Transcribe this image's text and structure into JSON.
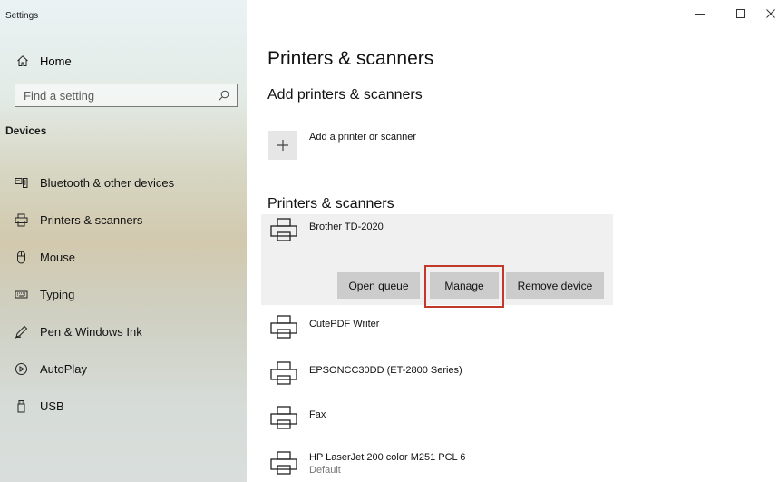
{
  "window": {
    "title": "Settings",
    "minimize_glyph": "–",
    "maximize_glyph": "☐",
    "close_glyph": "✕"
  },
  "sidebar": {
    "home_label": "Home",
    "search_placeholder": "Find a setting",
    "section_label": "Devices",
    "items": [
      {
        "label": "Bluetooth & other devices",
        "icon": "bluetooth-devices-icon"
      },
      {
        "label": "Printers & scanners",
        "icon": "printer-icon"
      },
      {
        "label": "Mouse",
        "icon": "mouse-icon"
      },
      {
        "label": "Typing",
        "icon": "keyboard-icon"
      },
      {
        "label": "Pen & Windows Ink",
        "icon": "pen-icon"
      },
      {
        "label": "AutoPlay",
        "icon": "autoplay-icon"
      },
      {
        "label": "USB",
        "icon": "usb-icon"
      }
    ]
  },
  "main": {
    "page_title": "Printers & scanners",
    "add_section_title": "Add printers & scanners",
    "add_button_label": "Add a printer or scanner",
    "list_section_title": "Printers & scanners",
    "printers": [
      {
        "name": "Brother TD-2020",
        "status": ""
      },
      {
        "name": "CutePDF Writer",
        "status": ""
      },
      {
        "name": "EPSONCC30DD (ET-2800 Series)",
        "status": ""
      },
      {
        "name": "Fax",
        "status": ""
      },
      {
        "name": "HP LaserJet 200 color M251 PCL 6",
        "status": "Default"
      }
    ],
    "actions": {
      "open_queue": "Open queue",
      "manage": "Manage",
      "remove_device": "Remove device"
    },
    "highlight_color": "#c0392b"
  }
}
